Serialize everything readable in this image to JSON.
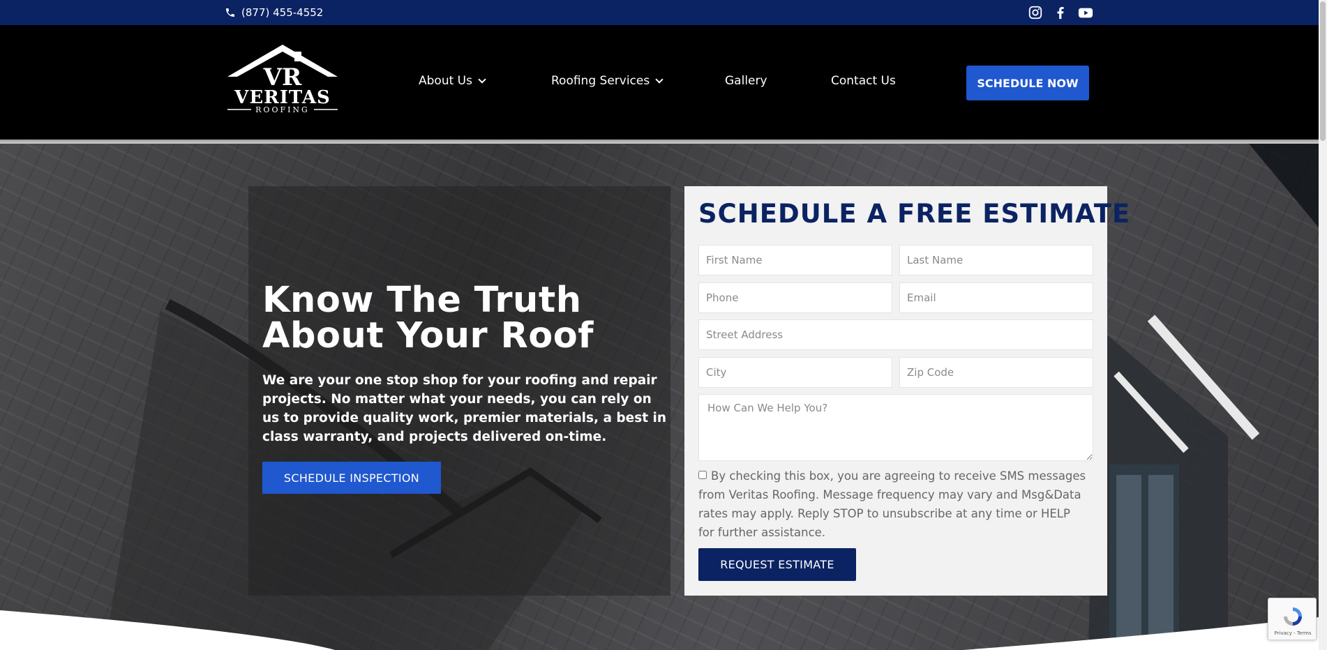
{
  "topbar": {
    "phone": "(877) 455-4552",
    "social_icons": [
      "instagram-icon",
      "facebook-icon",
      "youtube-icon"
    ]
  },
  "header": {
    "logo": {
      "name": "VERITAS",
      "sub": "ROOFING",
      "mark": "VR"
    },
    "nav": [
      {
        "label": "About Us",
        "has_dropdown": true
      },
      {
        "label": "Roofing Services",
        "has_dropdown": true
      },
      {
        "label": "Gallery",
        "has_dropdown": false
      },
      {
        "label": "Contact Us",
        "has_dropdown": false
      }
    ],
    "cta_label": "SCHEDULE NOW"
  },
  "hero": {
    "title_line1": "Know The Truth",
    "title_line2": "About Your Roof",
    "description": "We are your one stop shop for your roofing and repair projects. No matter what your needs, you can rely on us to provide quality work, premier materials, a best in class warranty, and projects delivered on-time.",
    "button_label": "SCHEDULE INSPECTION"
  },
  "form": {
    "title": "SCHEDULE A FREE ESTIMATE",
    "fields": {
      "first_name": {
        "placeholder": "First Name",
        "value": ""
      },
      "last_name": {
        "placeholder": "Last Name",
        "value": ""
      },
      "phone": {
        "placeholder": "Phone",
        "value": ""
      },
      "email": {
        "placeholder": "Email",
        "value": ""
      },
      "street": {
        "placeholder": "Street Address",
        "value": ""
      },
      "city": {
        "placeholder": "City",
        "value": ""
      },
      "zip": {
        "placeholder": "Zip Code",
        "value": ""
      },
      "message": {
        "placeholder": "How Can We Help You?",
        "value": ""
      }
    },
    "consent_checked": false,
    "consent_text": "By checking this box, you are agreeing to receive SMS messages from Veritas Roofing. Message frequency may vary and Msg&Data rates may apply. Reply STOP to unsubscribe at any time or HELP for further assistance.",
    "submit_label": "REQUEST ESTIMATE"
  },
  "recaptcha": {
    "text": "Privacy - Terms"
  },
  "colors": {
    "topbar": "#0b2363",
    "header": "#000000",
    "accent_blue": "#1f58cf",
    "navy": "#0b2363",
    "form_bg": "#f2f2f2"
  }
}
